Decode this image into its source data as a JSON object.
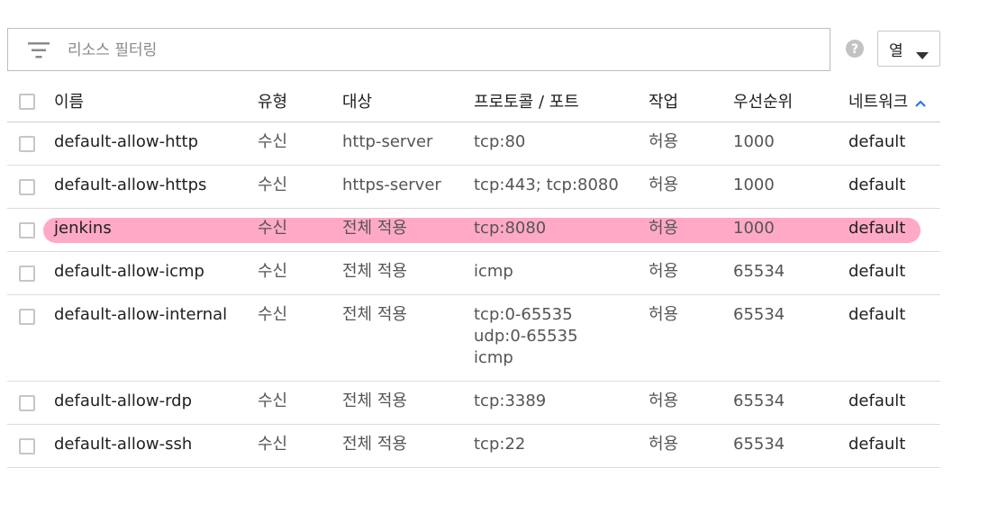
{
  "filter": {
    "placeholder": "리소스 필터링"
  },
  "columns_button": {
    "label": "열"
  },
  "headers": {
    "name": "이름",
    "type": "유형",
    "target": "대상",
    "protocol": "프로토콜 / 포트",
    "action": "작업",
    "priority": "우선순위",
    "network": "네트워크"
  },
  "rows": [
    {
      "name": "default-allow-http",
      "type": "수신",
      "target": "http-server",
      "protocol": [
        "tcp:80"
      ],
      "action": "허용",
      "priority": "1000",
      "network": "default"
    },
    {
      "name": "default-allow-https",
      "type": "수신",
      "target": "https-server",
      "protocol": [
        "tcp:443; tcp:8080"
      ],
      "action": "허용",
      "priority": "1000",
      "network": "default"
    },
    {
      "name": "jenkins",
      "type": "수신",
      "target": "전체 적용",
      "protocol": [
        "tcp:8080"
      ],
      "action": "허용",
      "priority": "1000",
      "network": "default"
    },
    {
      "name": "default-allow-icmp",
      "type": "수신",
      "target": "전체 적용",
      "protocol": [
        "icmp"
      ],
      "action": "허용",
      "priority": "65534",
      "network": "default"
    },
    {
      "name": "default-allow-internal",
      "type": "수신",
      "target": "전체 적용",
      "protocol": [
        "tcp:0-65535",
        "udp:0-65535",
        "icmp"
      ],
      "action": "허용",
      "priority": "65534",
      "network": "default"
    },
    {
      "name": "default-allow-rdp",
      "type": "수신",
      "target": "전체 적용",
      "protocol": [
        "tcp:3389"
      ],
      "action": "허용",
      "priority": "65534",
      "network": "default"
    },
    {
      "name": "default-allow-ssh",
      "type": "수신",
      "target": "전체 적용",
      "protocol": [
        "tcp:22"
      ],
      "action": "허용",
      "priority": "65534",
      "network": "default"
    }
  ],
  "colors": {
    "accent": "#1a73e8",
    "highlight": "#ffa9c6"
  }
}
